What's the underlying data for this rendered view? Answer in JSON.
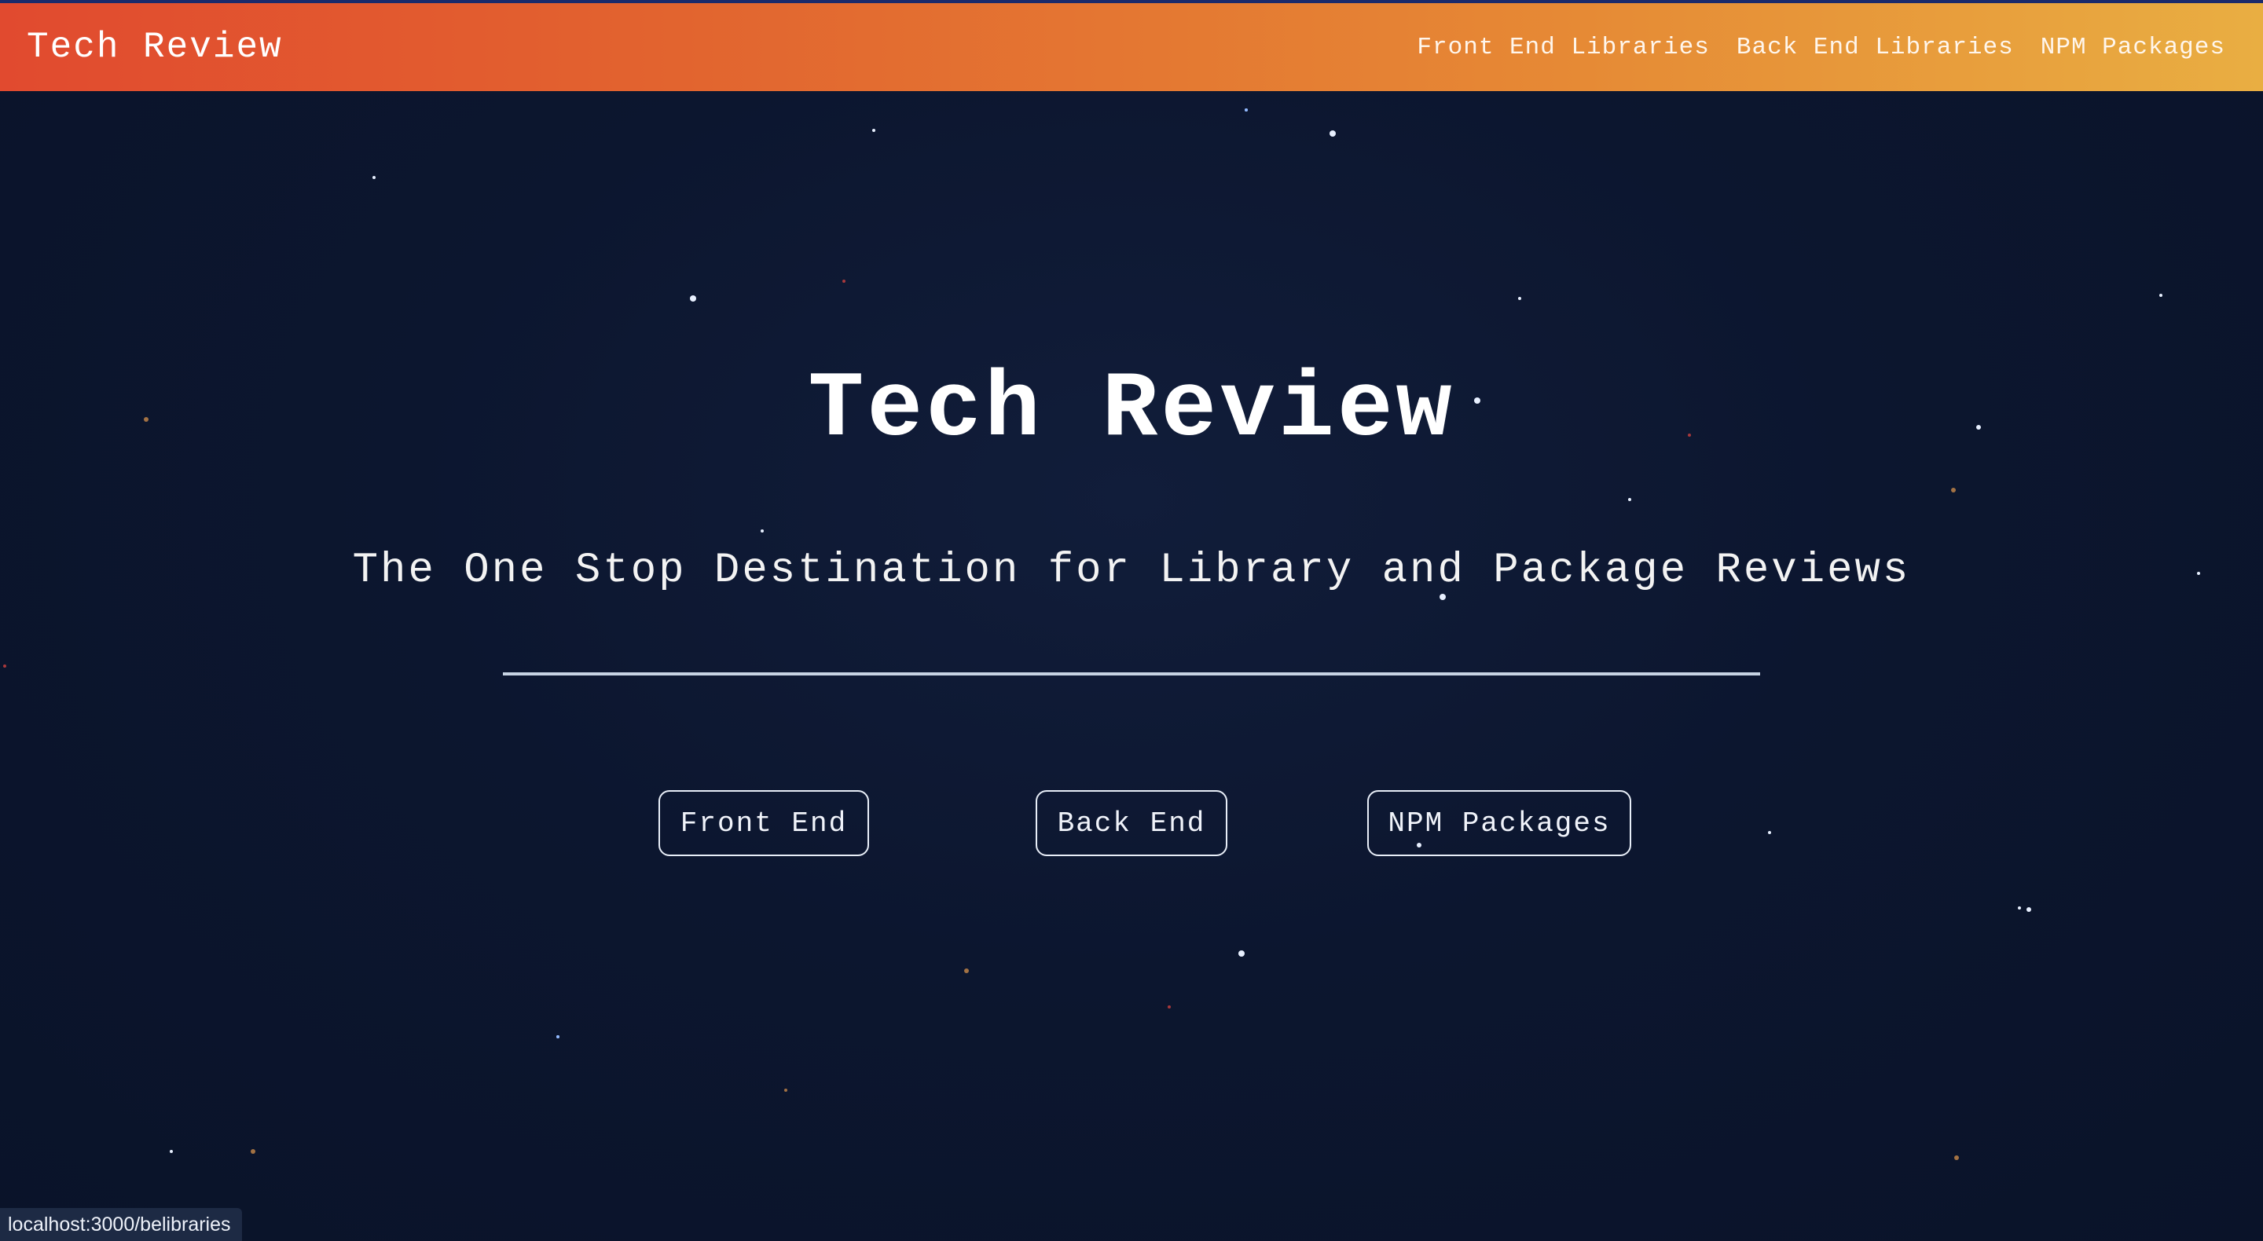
{
  "navbar": {
    "brand": "Tech Review",
    "links": [
      {
        "label": "Front End Libraries"
      },
      {
        "label": "Back End Libraries"
      },
      {
        "label": "NPM Packages"
      }
    ],
    "gradient_colors": [
      "#e14a2f",
      "#e9ae42"
    ]
  },
  "hero": {
    "title": "Tech Review",
    "subtitle": "The One Stop Destination for Library and Package Reviews",
    "buttons": [
      {
        "label": "Front End"
      },
      {
        "label": "Back End"
      },
      {
        "label": "NPM Packages"
      }
    ],
    "background": "starry-night-sky"
  },
  "status_bar": {
    "url": "localhost:3000/belibraries"
  },
  "colors": {
    "background": "#0b1530",
    "text": "#ffffff",
    "divider": "#c7d3e3"
  }
}
